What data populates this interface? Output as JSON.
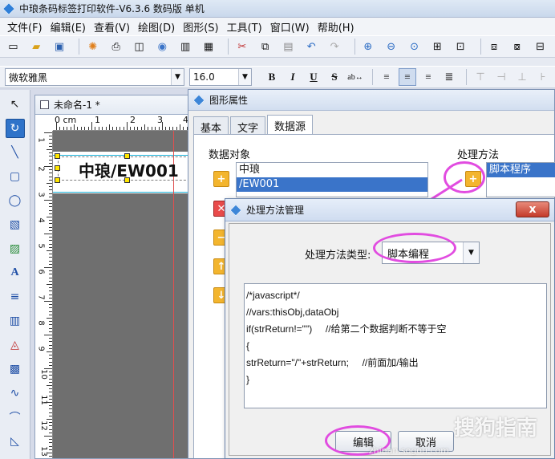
{
  "app": {
    "title": "中琅条码标签打印软件-V6.3.6 数码版 单机"
  },
  "menu": [
    "文件(F)",
    "编辑(E)",
    "查看(V)",
    "绘图(D)",
    "图形(S)",
    "工具(T)",
    "窗口(W)",
    "帮助(H)"
  ],
  "font_toolbar": {
    "font_name": "微软雅黑",
    "font_size": "16.0",
    "bold": "B",
    "italic": "I",
    "underline": "U",
    "strike": "S"
  },
  "document": {
    "tab_title": "未命名-1 *",
    "ruler_h": [
      "0 cm",
      "1",
      "2",
      "3",
      "4"
    ],
    "ruler_v": [
      "1",
      "2",
      "3",
      "4",
      "5",
      "6",
      "7",
      "8",
      "9",
      "10",
      "11",
      "12",
      "13"
    ],
    "label_text": "中琅/EW001"
  },
  "props_dialog": {
    "title": "图形属性",
    "tabs": [
      "基本",
      "文字",
      "数据源"
    ],
    "data_objects_label": "数据对象",
    "data_objects": [
      "中琅",
      "/EW001"
    ],
    "processing_label": "处理方法",
    "processing_items": [
      "脚本程序"
    ]
  },
  "manager_dialog": {
    "title": "处理方法管理",
    "close_label": "x",
    "type_label": "处理方法类型:",
    "type_value": "脚本编程",
    "code_lines": [
      "/*javascript*/",
      "//vars:thisObj,dataObj",
      "if(strReturn!=\"\")     //给第二个数据判断不等于空",
      "{",
      "strReturn=\"/\"+strReturn;     //前面加/输出",
      "}"
    ],
    "edit_button": "编辑",
    "cancel_button": "取消"
  },
  "watermark": {
    "brand": "搜狗指南",
    "url": "zhinan.sogou.com"
  },
  "annotation_color": "#e14ce0"
}
